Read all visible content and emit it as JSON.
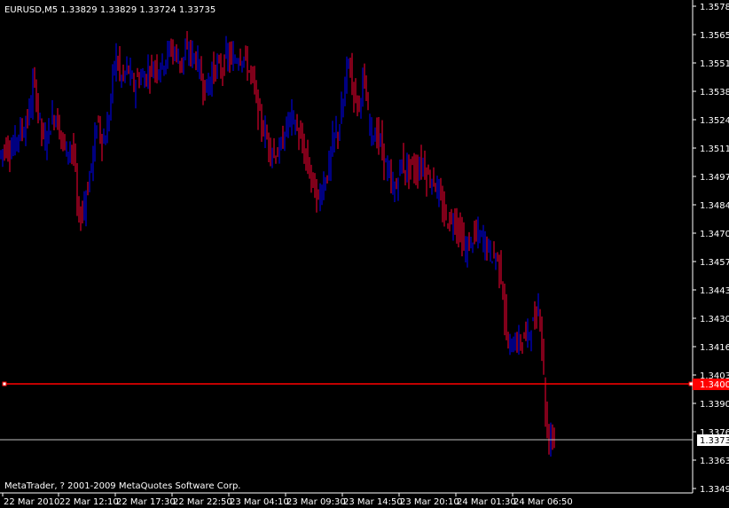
{
  "header": {
    "symbol_info": "EURUSD,M5  1.33829 1.33829 1.33724 1.33735"
  },
  "footer": {
    "copyright": "MetaTrader, ? 2001-2009 MetaQuotes Software Corp."
  },
  "colors": {
    "background": "#000000",
    "axis": "#ffffff",
    "bull": "#0000ff",
    "bear": "#ff0033",
    "level_line": "#ff0000",
    "bid_line": "#c0c0c0"
  },
  "chart_data": {
    "type": "candlestick",
    "symbol": "EURUSD",
    "timeframe": "M5",
    "last_bar": {
      "open": 1.33829,
      "high": 1.33829,
      "low": 1.33724,
      "close": 1.33735
    },
    "y_ticks": [
      "1.35785",
      "1.35650",
      "1.35515",
      "1.35380",
      "1.35245",
      "1.35110",
      "1.34975",
      "1.34840",
      "1.34705",
      "1.34570",
      "1.34435",
      "1.34300",
      "1.34165",
      "1.34030",
      "1.33900",
      "1.33765",
      "1.33630",
      "1.33495"
    ],
    "ylim": [
      1.33495,
      1.35785
    ],
    "x_ticks": [
      "22 Mar 2010",
      "22 Mar 12:10",
      "22 Mar 17:30",
      "22 Mar 22:50",
      "23 Mar 04:10",
      "23 Mar 09:30",
      "23 Mar 14:50",
      "23 Mar 20:10",
      "24 Mar 01:30",
      "24 Mar 06:50"
    ],
    "horizontal_lines": [
      {
        "price": 1.34005,
        "label": "1.34005",
        "color": "#ff0000"
      },
      {
        "price": 1.33735,
        "label": "1.33735",
        "color": "#c0c0c0"
      }
    ],
    "price_path": [
      [
        0,
        1.3507
      ],
      [
        8,
        1.3512
      ],
      [
        15,
        1.351
      ],
      [
        22,
        1.3518
      ],
      [
        30,
        1.3521
      ],
      [
        36,
        1.353
      ],
      [
        40,
        1.3544
      ],
      [
        46,
        1.3526
      ],
      [
        52,
        1.3513
      ],
      [
        58,
        1.3522
      ],
      [
        64,
        1.3528
      ],
      [
        70,
        1.3518
      ],
      [
        76,
        1.351
      ],
      [
        82,
        1.3512
      ],
      [
        86,
        1.3506
      ],
      [
        90,
        1.3476
      ],
      [
        96,
        1.3483
      ],
      [
        102,
        1.3495
      ],
      [
        108,
        1.3512
      ],
      [
        112,
        1.3526
      ],
      [
        118,
        1.3512
      ],
      [
        124,
        1.3522
      ],
      [
        128,
        1.354
      ],
      [
        132,
        1.3557
      ],
      [
        136,
        1.3548
      ],
      [
        140,
        1.3543
      ],
      [
        146,
        1.355
      ],
      [
        152,
        1.354
      ],
      [
        158,
        1.3545
      ],
      [
        164,
        1.3544
      ],
      [
        170,
        1.3548
      ],
      [
        176,
        1.355
      ],
      [
        182,
        1.355
      ],
      [
        188,
        1.3553
      ],
      [
        194,
        1.3559
      ],
      [
        200,
        1.3556
      ],
      [
        206,
        1.3551
      ],
      [
        212,
        1.3557
      ],
      [
        218,
        1.3556
      ],
      [
        224,
        1.3553
      ],
      [
        228,
        1.3546
      ],
      [
        234,
        1.3538
      ],
      [
        240,
        1.3546
      ],
      [
        246,
        1.355
      ],
      [
        252,
        1.3548
      ],
      [
        258,
        1.3556
      ],
      [
        264,
        1.3552
      ],
      [
        270,
        1.3555
      ],
      [
        276,
        1.3555
      ],
      [
        282,
        1.3549
      ],
      [
        288,
        1.3542
      ],
      [
        294,
        1.3526
      ],
      [
        300,
        1.3519
      ],
      [
        306,
        1.3512
      ],
      [
        312,
        1.3508
      ],
      [
        318,
        1.351
      ],
      [
        324,
        1.352
      ],
      [
        330,
        1.3527
      ],
      [
        336,
        1.3521
      ],
      [
        342,
        1.3513
      ],
      [
        348,
        1.3504
      ],
      [
        354,
        1.3496
      ],
      [
        360,
        1.3485
      ],
      [
        366,
        1.3494
      ],
      [
        372,
        1.35
      ],
      [
        378,
        1.3516
      ],
      [
        384,
        1.352
      ],
      [
        390,
        1.3535
      ],
      [
        394,
        1.3555
      ],
      [
        400,
        1.354
      ],
      [
        406,
        1.353
      ],
      [
        412,
        1.3545
      ],
      [
        418,
        1.3522
      ],
      [
        424,
        1.3518
      ],
      [
        430,
        1.3515
      ],
      [
        436,
        1.3505
      ],
      [
        442,
        1.3495
      ],
      [
        448,
        1.349
      ],
      [
        454,
        1.3505
      ],
      [
        460,
        1.35
      ],
      [
        466,
        1.3503
      ],
      [
        472,
        1.35
      ],
      [
        478,
        1.3505
      ],
      [
        484,
        1.3497
      ],
      [
        490,
        1.3497
      ],
      [
        496,
        1.349
      ],
      [
        502,
        1.348
      ],
      [
        508,
        1.3476
      ],
      [
        514,
        1.3478
      ],
      [
        520,
        1.3472
      ],
      [
        526,
        1.3462
      ],
      [
        532,
        1.3466
      ],
      [
        538,
        1.347
      ],
      [
        544,
        1.3469
      ],
      [
        550,
        1.3466
      ],
      [
        556,
        1.346
      ],
      [
        562,
        1.346
      ],
      [
        568,
        1.3449
      ],
      [
        572,
        1.3425
      ],
      [
        576,
        1.3415
      ],
      [
        582,
        1.342
      ],
      [
        588,
        1.3418
      ],
      [
        594,
        1.3422
      ],
      [
        600,
        1.3425
      ],
      [
        606,
        1.343
      ],
      [
        610,
        1.3438
      ],
      [
        614,
        1.3412
      ],
      [
        617,
        1.3385
      ],
      [
        620,
        1.337
      ],
      [
        624,
        1.3378
      ],
      [
        626,
        1.3374
      ]
    ]
  }
}
